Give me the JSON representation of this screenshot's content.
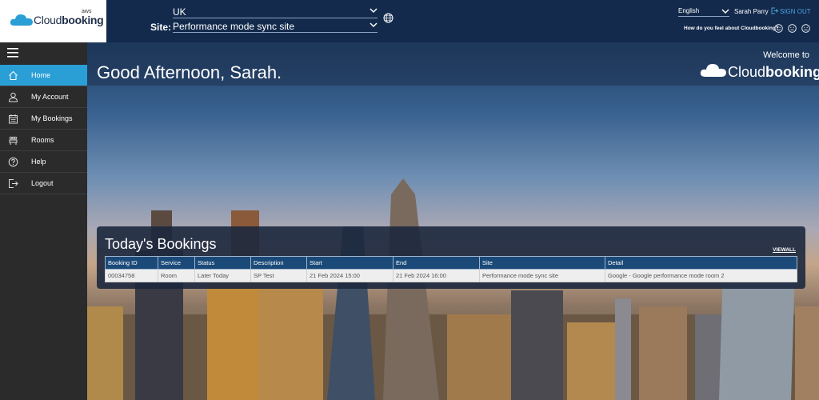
{
  "header": {
    "logo_text_light": "Cloud",
    "logo_text_bold": "booking",
    "logo_badge": "aws",
    "region_value": "UK",
    "site_label": "Site:",
    "site_value": "Performance mode sync site",
    "language_value": "English",
    "user_name": "Sarah Parry",
    "sign_out_label": "SIGN OUT",
    "feedback_prompt": "How do you feel about Cloudbooking?"
  },
  "sidebar": {
    "items": [
      {
        "label": "Home",
        "icon": "home-icon",
        "active": true
      },
      {
        "label": "My Account",
        "icon": "user-icon",
        "active": false
      },
      {
        "label": "My Bookings",
        "icon": "calendar-icon",
        "active": false
      },
      {
        "label": "Rooms",
        "icon": "rooms-icon",
        "active": false
      },
      {
        "label": "Help",
        "icon": "help-icon",
        "active": false
      },
      {
        "label": "Logout",
        "icon": "logout-icon",
        "active": false
      }
    ]
  },
  "main": {
    "greeting": "Good Afternoon, Sarah.",
    "welcome_to": "Welcome to",
    "brand_light": "Cloud",
    "brand_bold": "booking"
  },
  "bookings": {
    "title": "Today's Bookings",
    "view_all": "VIEWALL",
    "columns": [
      "Booking ID",
      "Service",
      "Status",
      "Description",
      "Start",
      "End",
      "Site",
      "Detail"
    ],
    "rows": [
      [
        "00034758",
        "Room",
        "Later Today",
        "SP Test",
        "21 Feb 2024 15:00",
        "21 Feb 2024 16:00",
        "Performance mode sync site",
        "Google - Google performance mode room 2"
      ]
    ]
  },
  "colors": {
    "header_bg": "#132a4c",
    "sidebar_bg": "#2b2b2b",
    "active_nav": "#2a9fd6",
    "table_header": "#1b4a79",
    "signout": "#4da3e0"
  }
}
